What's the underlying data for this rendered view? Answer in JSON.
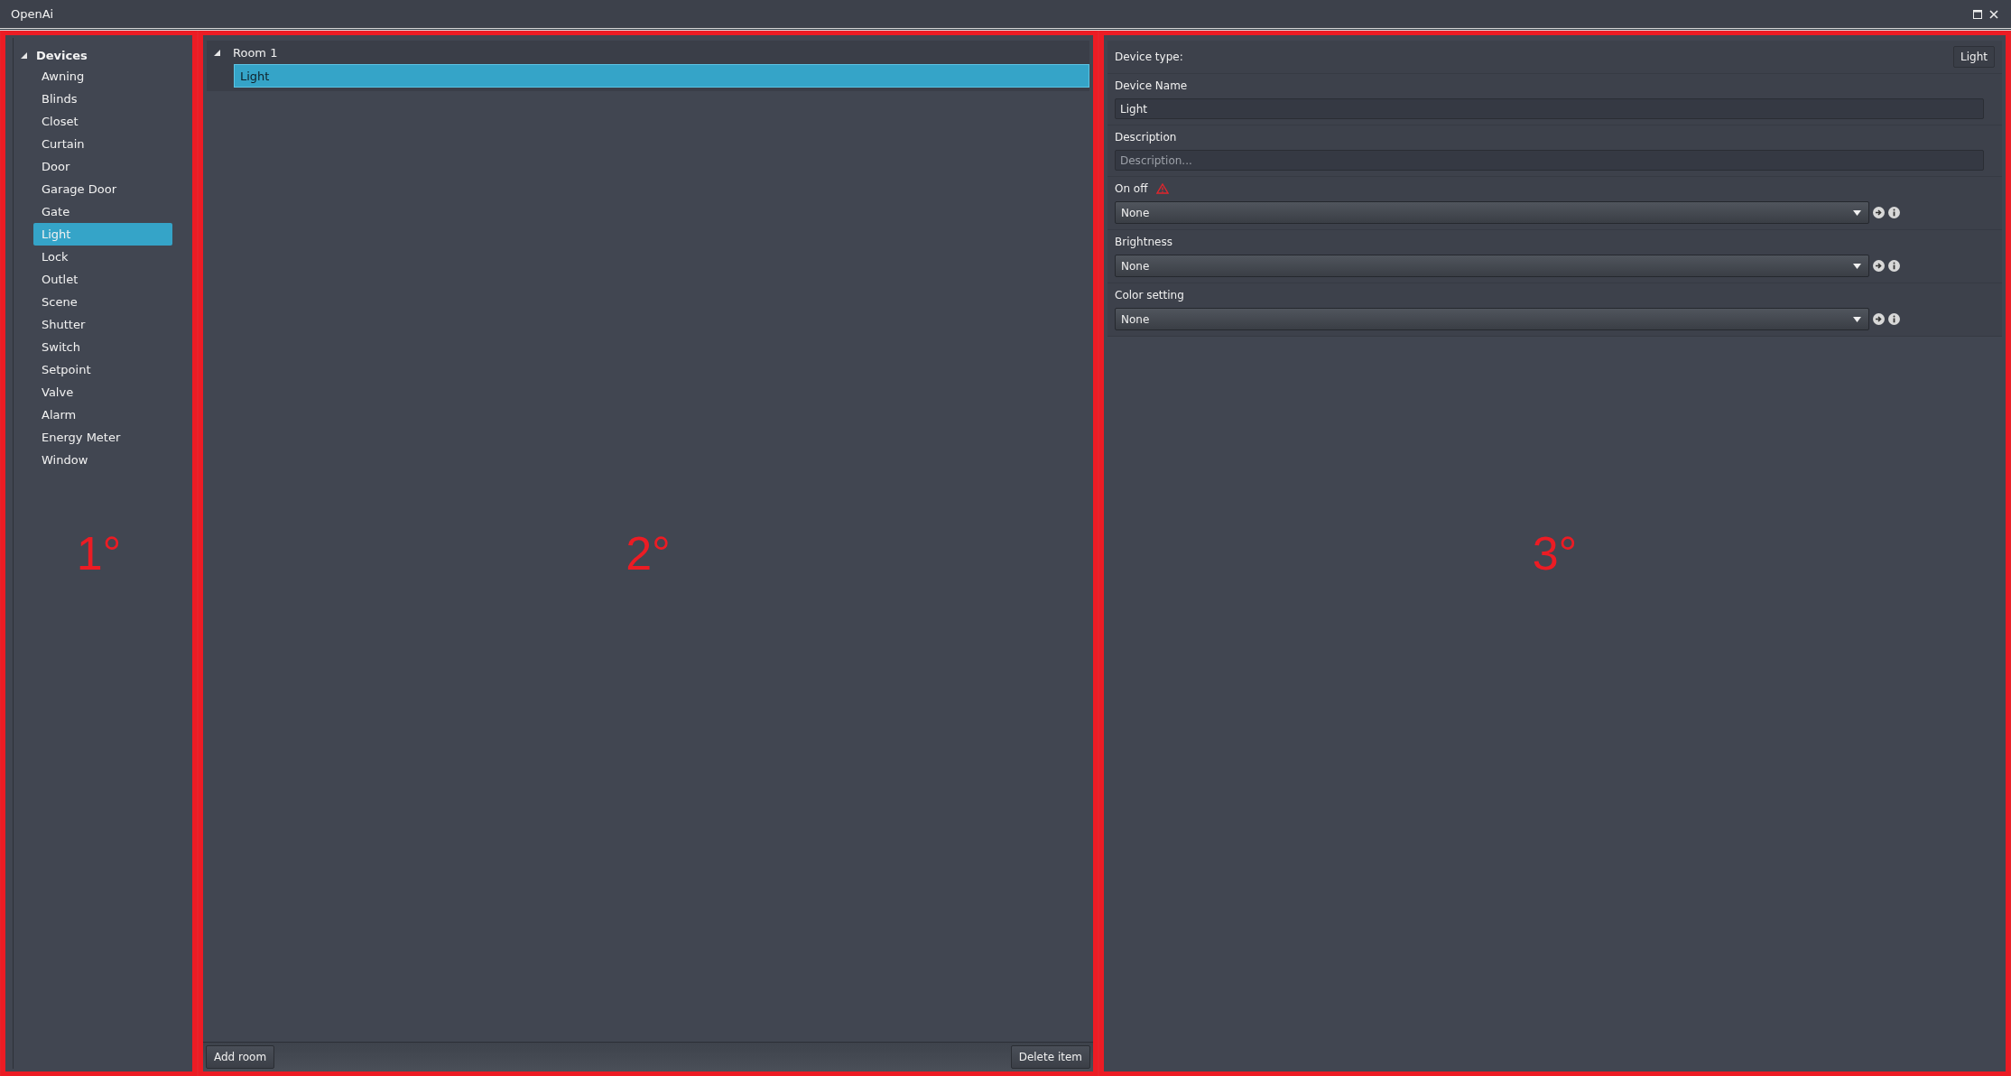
{
  "window": {
    "title": "OpenAi"
  },
  "device_tree": {
    "label": "Devices",
    "expanded": true,
    "children": [
      {
        "label": "Awning",
        "selected": false
      },
      {
        "label": "Blinds",
        "selected": false
      },
      {
        "label": "Closet",
        "selected": false
      },
      {
        "label": "Curtain",
        "selected": false
      },
      {
        "label": "Door",
        "selected": false
      },
      {
        "label": "Garage Door",
        "selected": false
      },
      {
        "label": "Gate",
        "selected": false
      },
      {
        "label": "Light",
        "selected": true
      },
      {
        "label": "Lock",
        "selected": false
      },
      {
        "label": "Outlet",
        "selected": false
      },
      {
        "label": "Scene",
        "selected": false
      },
      {
        "label": "Shutter",
        "selected": false
      },
      {
        "label": "Switch",
        "selected": false
      },
      {
        "label": "Setpoint",
        "selected": false
      },
      {
        "label": "Valve",
        "selected": false
      },
      {
        "label": "Alarm",
        "selected": false
      },
      {
        "label": "Energy Meter",
        "selected": false
      },
      {
        "label": "Window",
        "selected": false
      }
    ]
  },
  "rooms": {
    "items": [
      {
        "label": "Room 1",
        "expanded": true,
        "children": [
          {
            "label": "Light",
            "selected": true
          }
        ]
      }
    ],
    "buttons": [
      "Add room",
      "Delete item"
    ]
  },
  "properties": {
    "device_type": {
      "label": "Device type:",
      "value": "Light"
    },
    "device_name": {
      "label": "Device Name",
      "value": "Light"
    },
    "description": {
      "label": "Description",
      "placeholder": "Description..."
    },
    "mappings": [
      {
        "label": "On off",
        "warning": true,
        "value": "None"
      },
      {
        "label": "Brightness",
        "warning": false,
        "value": "None"
      },
      {
        "label": "Color setting",
        "warning": false,
        "value": "None"
      }
    ]
  },
  "annotations": [
    "1°",
    "2°",
    "3°"
  ]
}
